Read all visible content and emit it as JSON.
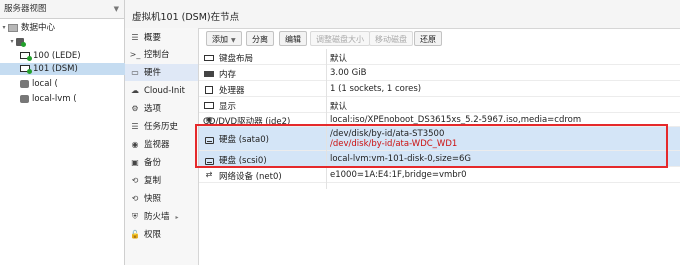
{
  "tree": {
    "view_label": "服务器视图",
    "datacenter": "数据中心",
    "node": "",
    "items": [
      {
        "label": "100 (LEDE)"
      },
      {
        "label": "101 (DSM)"
      },
      {
        "label": "local ("
      },
      {
        "label": "local-lvm ("
      }
    ]
  },
  "header": {
    "title": "虚拟机101 (DSM)在节点"
  },
  "subnav": {
    "items": [
      {
        "icon": "☰",
        "label": "概要"
      },
      {
        "icon": ">_",
        "label": "控制台"
      },
      {
        "icon": "▭",
        "label": "硬件"
      },
      {
        "icon": "☁",
        "label": "Cloud-Init"
      },
      {
        "icon": "⚙",
        "label": "选项"
      },
      {
        "icon": "☰",
        "label": "任务历史"
      },
      {
        "icon": "◉",
        "label": "监视器"
      },
      {
        "icon": "▣",
        "label": "备份"
      },
      {
        "icon": "⟲",
        "label": "复制"
      },
      {
        "icon": "⟲",
        "label": "快照"
      },
      {
        "icon": "⛨",
        "label": "防火墙"
      },
      {
        "icon": "🔓",
        "label": "权限"
      }
    ]
  },
  "toolbar": {
    "add": "添加",
    "split": "分离",
    "edit": "编辑",
    "resize": "调整磁盘大小",
    "move": "移动磁盘",
    "revert": "还原"
  },
  "hardware": [
    {
      "icon": "keyboard-icon",
      "name": "键盘布局",
      "value": "默认"
    },
    {
      "icon": "memory-icon",
      "name": "内存",
      "value": "3.00 GiB"
    },
    {
      "icon": "cpu-icon",
      "name": "处理器",
      "value": "1 (1 sockets, 1 cores)"
    },
    {
      "icon": "monitor-icon",
      "name": "显示",
      "value": "默认"
    },
    {
      "icon": "cdrom-icon",
      "name": "CD/DVD驱动器 (ide2)",
      "value": "local:iso/XPEnoboot_DS3615xs_5.2-5967.iso,media=cdrom"
    },
    {
      "icon": "disk-icon",
      "name": "硬盘 (sata0)",
      "value": "/dev/disk/by-id/ata-ST3500",
      "value2": "/dev/disk/by-id/ata-WDC_WD1"
    },
    {
      "icon": "disk-icon",
      "name": "硬盘 (scsi0)",
      "value": "local-lvm:vm-101-disk-0,size=6G"
    },
    {
      "icon": "network-icon",
      "name": "网络设备 (net0)",
      "value": "e1000=1A:E4:1F",
      "value_tail": ",bridge=vmbr0"
    }
  ],
  "colors": {
    "selection": "#c5dcf1",
    "highlight_border": "#e5292b",
    "red_text": "#cc1111"
  }
}
